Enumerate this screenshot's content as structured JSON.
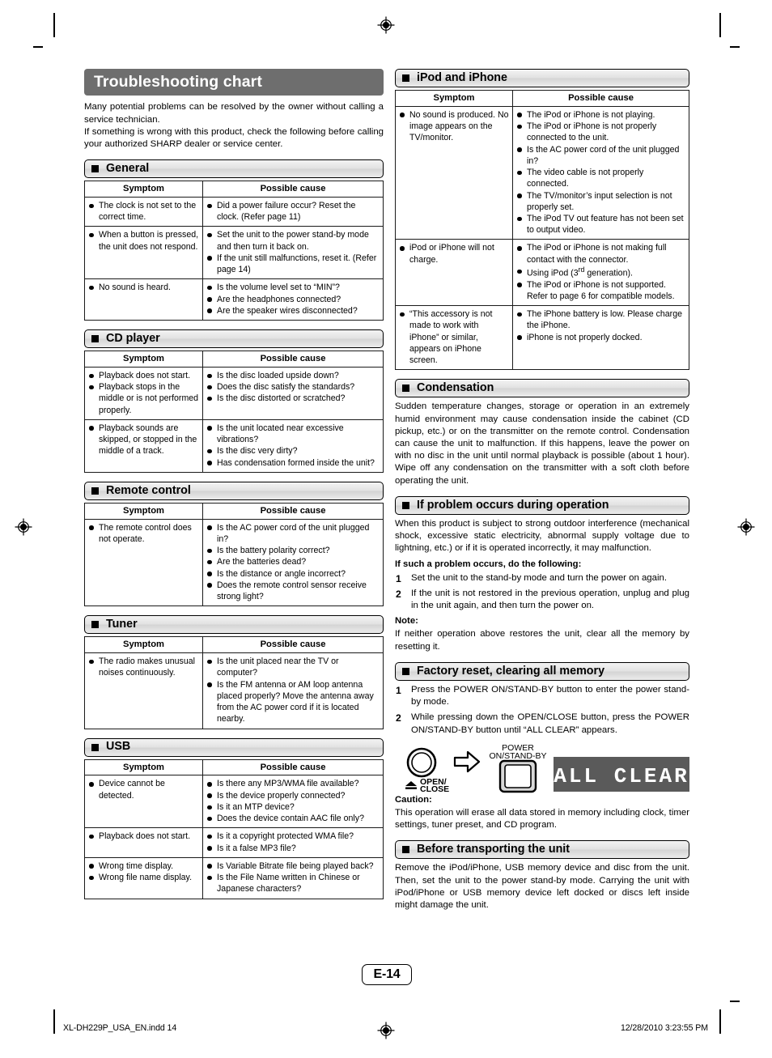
{
  "document": {
    "title": "Troubleshooting chart",
    "intro_paragraph_1": "Many potential problems can be resolved by the owner without calling a service technician.",
    "intro_paragraph_2": "If something is wrong with this product, check the following before calling your authorized SHARP dealer or service center.",
    "page_number": "E-14",
    "footer_left": "XL-DH229P_USA_EN.indd   14",
    "footer_right": "12/28/2010   3:23:55 PM"
  },
  "table_headers": {
    "symptom": "Symptom",
    "possible_cause": "Possible cause"
  },
  "sections": {
    "general": {
      "heading": "General",
      "rows": [
        {
          "symptom": [
            "The clock is not set to the correct time."
          ],
          "cause": [
            "Did a power failure occur? Reset the clock. (Refer page 11)"
          ]
        },
        {
          "symptom": [
            "When a button is pressed, the unit does not respond."
          ],
          "cause": [
            "Set the unit to the power stand-by mode and then turn it back on.",
            "If the unit still malfunctions, reset it. (Refer page 14)"
          ]
        },
        {
          "symptom": [
            "No sound is heard."
          ],
          "cause": [
            "Is the volume level set to “MIN”?",
            "Are the headphones connected?",
            "Are the speaker wires disconnected?"
          ]
        }
      ]
    },
    "cd_player": {
      "heading": "CD player",
      "rows": [
        {
          "symptom": [
            "Playback does not start.",
            "Playback stops in the middle or is not performed properly."
          ],
          "cause": [
            "Is the disc loaded upside down?",
            "Does the disc satisfy the standards?",
            "Is the disc distorted or scratched?"
          ]
        },
        {
          "symptom": [
            "Playback sounds are skipped, or stopped in the middle of a track."
          ],
          "cause": [
            "Is the unit located near excessive vibrations?",
            "Is the disc very dirty?",
            "Has condensation formed inside the unit?"
          ]
        }
      ]
    },
    "remote_control": {
      "heading": "Remote control",
      "rows": [
        {
          "symptom": [
            "The remote control does not operate."
          ],
          "cause": [
            "Is the AC power cord of the unit plugged in?",
            "Is the battery polarity correct?",
            "Are the batteries dead?",
            "Is the distance or angle incorrect?",
            "Does the remote control sensor receive strong light?"
          ]
        }
      ]
    },
    "tuner": {
      "heading": "Tuner",
      "rows": [
        {
          "symptom": [
            "The radio makes unusual noises continuously."
          ],
          "cause": [
            "Is the unit placed near the TV or computer?",
            "Is the FM antenna or AM loop antenna placed properly? Move the antenna away from the AC power cord if it is located nearby."
          ]
        }
      ]
    },
    "usb": {
      "heading": "USB",
      "rows": [
        {
          "symptom": [
            "Device cannot be detected."
          ],
          "cause": [
            "Is there any MP3/WMA file available?",
            "Is the device properly connected?",
            "Is it an MTP device?",
            "Does the device contain AAC file only?"
          ]
        },
        {
          "symptom": [
            "Playback does not start."
          ],
          "cause": [
            "Is it a copyright protected WMA file?",
            "Is it a false MP3 file?"
          ]
        },
        {
          "symptom": [
            "Wrong time display.",
            "Wrong file name display."
          ],
          "cause": [
            "Is Variable Bitrate file being played back?",
            "Is the File Name written in Chinese or Japanese characters?"
          ]
        }
      ]
    },
    "ipod_iphone": {
      "heading": "iPod and iPhone",
      "rows": [
        {
          "symptom": [
            "No sound is produced. No image appears on the TV/monitor."
          ],
          "cause": [
            "The iPod or iPhone is not playing.",
            "The iPod or iPhone is not properly connected to the unit.",
            "Is the AC power cord of the unit plugged in?",
            "The video cable is not properly connected.",
            "The TV/monitor’s input selection is not properly set.",
            "The iPod TV out feature has not been set to output video."
          ]
        },
        {
          "symptom": [
            "iPod or iPhone will not charge."
          ],
          "cause_html": [
            "The iPod or iPhone is not making full contact with the  connector.",
            "Using iPod (3<sup>rd</sup> generation).",
            "The iPod or iPhone is not supported. Refer to page 6 for compatible models."
          ]
        },
        {
          "symptom": [
            "“This accessory is not made to work with iPhone” or similar, appears on iPhone screen."
          ],
          "cause": [
            "The iPhone battery is low. Please charge the iPhone.",
            "iPhone is not properly docked."
          ]
        }
      ]
    },
    "condensation": {
      "heading": "Condensation",
      "body": "Sudden temperature changes, storage or operation in an extremely humid environment may cause condensation inside the cabinet (CD pickup, etc.) or on the transmitter on the remote control. Condensation can cause the unit to malfunction. If this happens, leave the power on with no disc in the unit until normal playback is possible (about 1 hour). Wipe off any condensation on the transmitter with a soft cloth before operating the unit."
    },
    "problem_during_operation": {
      "heading": "If problem occurs during operation",
      "body": "When this product is subject to strong outdoor interference (mechanical shock, excessive static electricity, abnormal supply voltage due to lightning, etc.) or if it is operated incorrectly, it may malfunction.",
      "subhead": "If such a problem occurs, do the following:",
      "steps": [
        {
          "num": "1",
          "text": "Set the unit to the stand-by mode and turn the power on again."
        },
        {
          "num": "2",
          "text": "If the unit is not restored in the previous operation, unplug and plug in the unit again, and then turn the power on."
        }
      ],
      "note_label": "Note:",
      "note_body": "If neither operation above restores the unit, clear all the memory by resetting it."
    },
    "factory_reset": {
      "heading": "Factory reset, clearing all memory",
      "steps": [
        {
          "num": "1",
          "text": "Press the POWER ON/STAND-BY button to enter the power stand-by mode."
        },
        {
          "num": "2",
          "text": "While pressing down the OPEN/CLOSE button, press the POWER ON/STAND-BY button until “ALL CLEAR” appears."
        }
      ],
      "diagram": {
        "open_close_label_1": "OPEN/",
        "open_close_label_2": "CLOSE",
        "power_label_1": "POWER",
        "power_label_2": "ON/STAND-BY",
        "display_text": "ALL CLEAR"
      },
      "caution_label": "Caution:",
      "caution_body": "This operation will erase all data stored in memory including clock, timer settings, tuner preset, and CD program."
    },
    "before_transporting": {
      "heading": "Before transporting the unit",
      "body": "Remove the iPod/iPhone, USB memory device and disc from the unit. Then, set the unit to the power stand-by mode. Carrying the unit with iPod/iPhone or USB memory device left docked or discs left inside might damage the unit."
    }
  },
  "colors": {
    "title_bar": "#6e6e6e",
    "section_header_bg": "#e2e2e2",
    "display_bg": "#5a5a5a",
    "rule": "#000000"
  }
}
